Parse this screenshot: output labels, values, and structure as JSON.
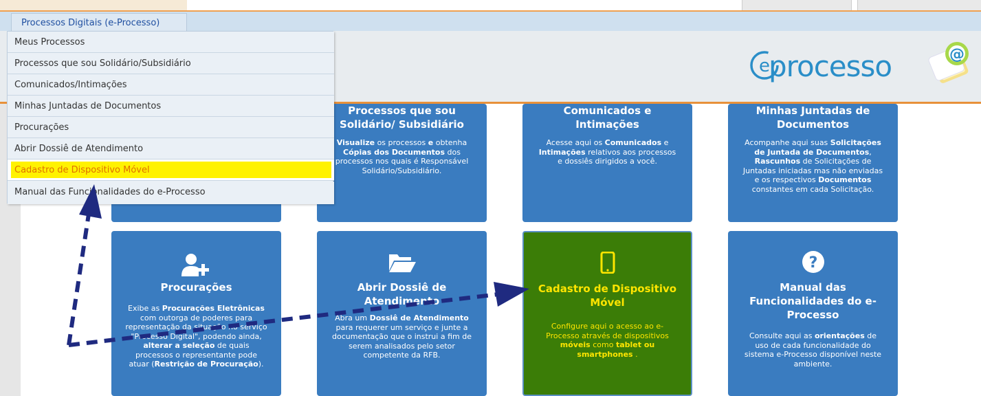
{
  "menu": {
    "tab_label": "Processos Digitais (e-Processo)",
    "items": [
      "Meus Processos",
      "Processos que sou Solidário/Subsidiário",
      "Comunicados/Intimações",
      "Minhas Juntadas de Documentos",
      "Procurações",
      "Abrir Dossiê de Atendimento",
      "Cadastro de Dispositivo Móvel",
      "Manual das Funcionalidades do e-Processo"
    ]
  },
  "logo": {
    "text": "processo"
  },
  "cards": {
    "processos_solidario": {
      "title_1": "Processos que sou",
      "title_2": "Solidário/ Subsidiário",
      "d1": "Visualize",
      "d2": " os processos ",
      "d3": "e",
      "d4": " obtenha",
      "d5": "Cópias dos Documentos",
      "d6": " dos",
      "d7": "processos nos quais é Responsável",
      "d8": "Solidário/Subsidiário."
    },
    "comunicados": {
      "title_1": "Comunicados e",
      "title_2": "Intimações",
      "d1": "Acesse aqui os ",
      "d2": "Comunicados",
      "d3": " e",
      "d4": "Intimações",
      "d5": " relativos aos processos",
      "d6": "e dossiês dirigidos a você."
    },
    "juntadas": {
      "title_1": "Minhas Juntadas de",
      "title_2": "Documentos",
      "d1": "Acompanhe aqui suas ",
      "d2": "Solicitações",
      "d3": "de Juntada de Documentos",
      "d4": ",",
      "d5": "Rascunhos",
      "d6": " de Solicitações de",
      "d7": "Juntadas iniciadas mas não enviadas",
      "d8": "e os respectivos ",
      "d9": "Documentos",
      "d10": "constantes em cada Solicitação."
    },
    "procuracoes": {
      "title": "Procurações",
      "d1": "Exibe as ",
      "d2": "Procurações Eletrônicas",
      "d3": "com outorga de poderes para",
      "d4": "representação da situação no serviço",
      "d5": "\"Processo Digital\", podendo ainda,",
      "d6": "alterar a seleção",
      "d7": " de quais",
      "d8": "processos o representante pode",
      "d9": "atuar (",
      "d10": "Restrição de Procuração",
      "d11": ")."
    },
    "dossie": {
      "title_1": "Abrir Dossiê de",
      "title_2": "Atendimento",
      "d1": "Abra um ",
      "d2": "Dossiê de Atendimento",
      "d3": "para requerer um serviço e junte a",
      "d4": "documentação que o instrui a fim de",
      "d5": "serem analisados pelo setor",
      "d6": "competente da RFB."
    },
    "dispositivo": {
      "title_1": "Cadastro de Dispositivo",
      "title_2": "Móvel",
      "d1": "Configure aqui o acesso ao e-",
      "d2": "Processo através de dispositivos",
      "d3": "móveis",
      "d4": " como ",
      "d5": "tablet ou",
      "d6": "smartphones",
      "d7": " ."
    },
    "manual": {
      "title_1": "Manual das",
      "title_2": "Funcionalidades do e-",
      "title_3": "Processo",
      "d1": "Consulte aqui as ",
      "d2": "orientações",
      "d3": " de",
      "d4": "uso de cada funcionalidade do",
      "d5": "sistema e-Processo disponível neste",
      "d6": "ambiente."
    }
  },
  "colors": {
    "card_blue": "#3a7cc0",
    "card_green": "#3b7d07",
    "highlight_yellow": "#fff200",
    "annotation_arrow": "#1f2a80"
  }
}
